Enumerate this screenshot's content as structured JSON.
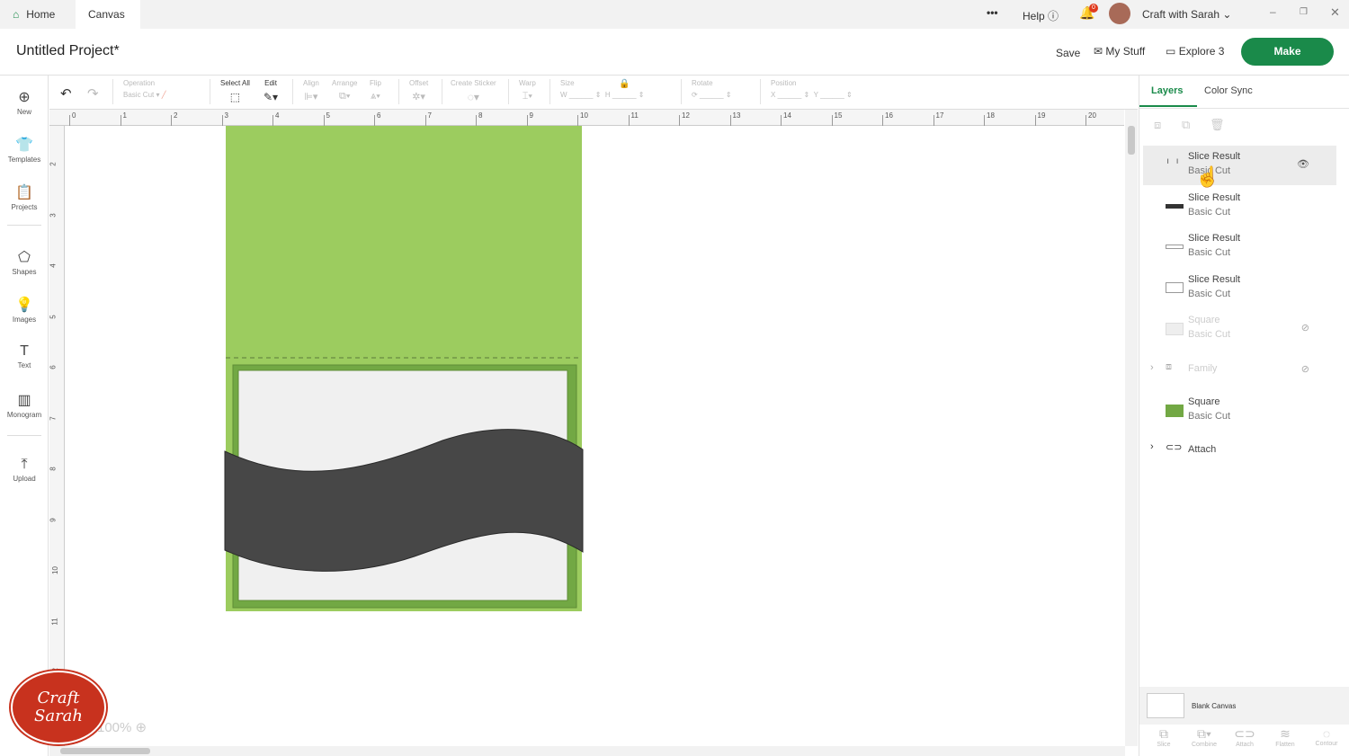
{
  "tabs": [
    {
      "label": "Home"
    },
    {
      "label": "Canvas"
    }
  ],
  "topbar": {
    "more": "•••",
    "help": "Help",
    "notif_count": "0",
    "user": "Craft with Sarah"
  },
  "header": {
    "title": "Untitled Project*",
    "save": "Save",
    "my_stuff": "My Stuff",
    "machine": "Explore 3",
    "make": "Make"
  },
  "toolbar": {
    "operation": "Operation",
    "operation_value": "Basic Cut",
    "select_all": "Select All",
    "edit": "Edit",
    "align": "Align",
    "arrange": "Arrange",
    "flip": "Flip",
    "offset": "Offset",
    "create_sticker": "Create Sticker",
    "warp": "Warp",
    "size": "Size",
    "w": "W",
    "h": "H",
    "rotate": "Rotate",
    "position": "Position",
    "x": "X",
    "y": "Y"
  },
  "leftbar": [
    {
      "label": "New"
    },
    {
      "label": "Templates"
    },
    {
      "label": "Projects"
    },
    {
      "label": "Shapes"
    },
    {
      "label": "Images"
    },
    {
      "label": "Text"
    },
    {
      "label": "Monogram"
    },
    {
      "label": "Upload"
    }
  ],
  "ruler_h": [
    "0",
    "1",
    "2",
    "3",
    "4",
    "5",
    "6",
    "7",
    "8",
    "9",
    "10",
    "11",
    "12",
    "13",
    "14",
    "15",
    "16",
    "17",
    "18",
    "19",
    "20"
  ],
  "ruler_v": [
    "2",
    "3",
    "4",
    "5",
    "6",
    "7",
    "8",
    "9",
    "10",
    "11",
    "12"
  ],
  "zoom": "100%",
  "watermark": "Craft with Sarah",
  "panel": {
    "tabs": [
      "Layers",
      "Color Sync"
    ],
    "layers": [
      {
        "name": "Slice Result",
        "op": "Basic Cut"
      },
      {
        "name": "Slice Result",
        "op": "Basic Cut"
      },
      {
        "name": "Slice Result",
        "op": "Basic Cut"
      },
      {
        "name": "Slice Result",
        "op": "Basic Cut"
      },
      {
        "name": "Square",
        "op": "Basic Cut"
      },
      {
        "name": "Family"
      },
      {
        "name": "Square",
        "op": "Basic Cut"
      },
      {
        "name": "Attach"
      }
    ],
    "blank_canvas": "Blank Canvas",
    "actions": [
      "Slice",
      "Combine",
      "Attach",
      "Flatten",
      "Contour"
    ]
  },
  "colors": {
    "accent": "#1a8a4a",
    "green": "#9ccc5f",
    "dark_green": "#72a844",
    "band": "#474747"
  }
}
